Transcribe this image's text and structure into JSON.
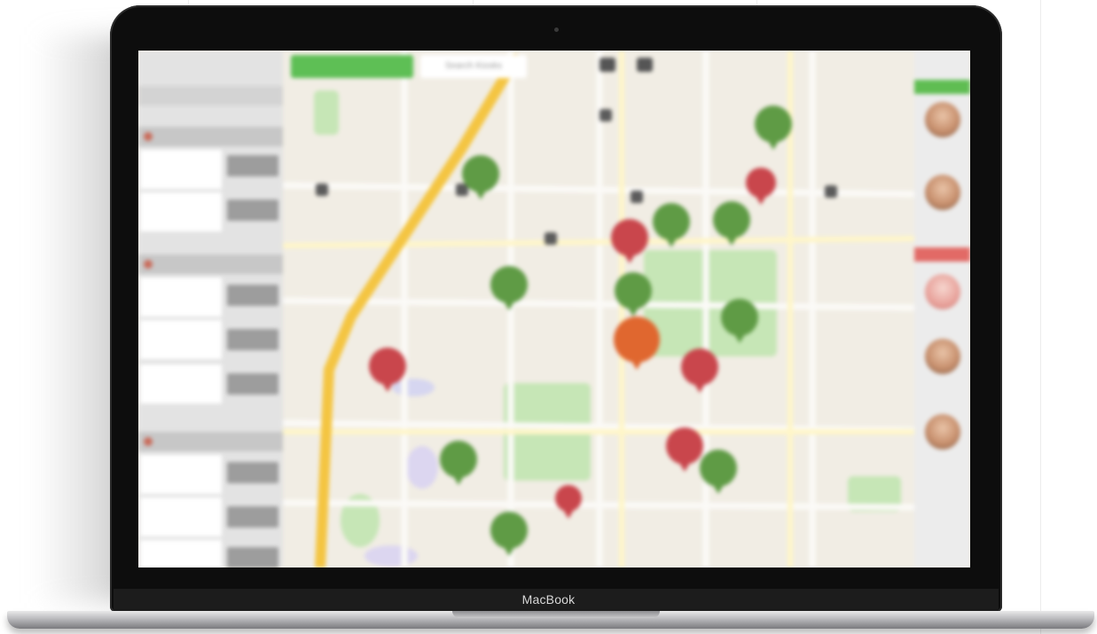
{
  "device": {
    "brand_label": "MacBook"
  },
  "app": {
    "search_placeholder": "Search Kiosks",
    "sidebar": {
      "groups": [
        "group-1",
        "group-2",
        "group-3"
      ]
    },
    "map": {
      "marker_colors": {
        "green": "#5f9b45",
        "red": "#c9464c",
        "orange": "#e0672f"
      },
      "road_color": "#f4c542",
      "park_color": "#c6e6b6"
    },
    "right_panel": {
      "accent_green": "#5fbd52",
      "accent_red": "#e26a66"
    }
  }
}
